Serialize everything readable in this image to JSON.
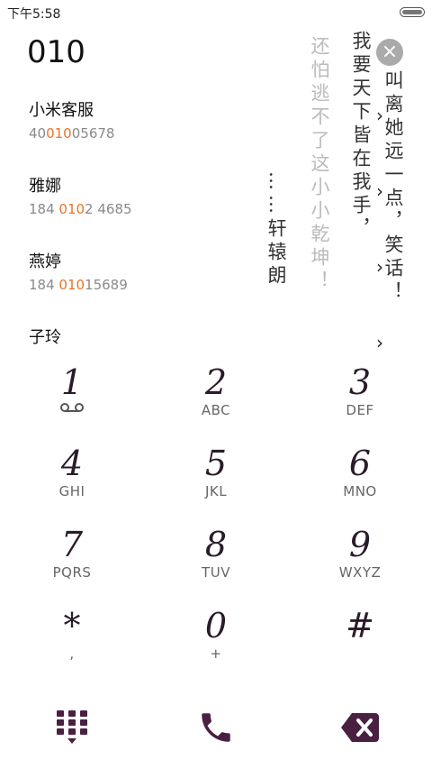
{
  "status_bar": {
    "time": "下午5:58"
  },
  "dialer": {
    "input_value": "010"
  },
  "results": [
    {
      "name": "小米客服",
      "num_pre": "40",
      "num_hl": "010",
      "num_post": "05678"
    },
    {
      "name": "雅娜",
      "num_pre": "184 ",
      "num_hl": "010",
      "num_post": "2 4685"
    },
    {
      "name": "燕婷",
      "num_pre": "184 ",
      "num_hl": "010",
      "num_post": "15689"
    },
    {
      "name": "子玲",
      "num_pre": "",
      "num_hl": "",
      "num_post": ""
    }
  ],
  "overlay_poem": {
    "col1": "叫离她远一点，笑话！",
    "col2": "我要天下皆在我手，",
    "col3": "还怕逃不了这小小乾坤！",
    "col4": "……轩辕朗"
  },
  "keypad": [
    {
      "digit": "1",
      "letters": ""
    },
    {
      "digit": "2",
      "letters": "ABC"
    },
    {
      "digit": "3",
      "letters": "DEF"
    },
    {
      "digit": "4",
      "letters": "GHI"
    },
    {
      "digit": "5",
      "letters": "JKL"
    },
    {
      "digit": "6",
      "letters": "MNO"
    },
    {
      "digit": "7",
      "letters": "PQRS"
    },
    {
      "digit": "8",
      "letters": "TUV"
    },
    {
      "digit": "9",
      "letters": "WXYZ"
    },
    {
      "digit": "*",
      "letters": ","
    },
    {
      "digit": "0",
      "letters": "+"
    },
    {
      "digit": "#",
      "letters": ""
    }
  ],
  "icons": {
    "close": "close-icon",
    "voicemail": "voicemail-icon",
    "dialpad_toggle": "dialpad-icon",
    "call": "phone-icon",
    "backspace": "backspace-icon"
  },
  "colors": {
    "accent": "#4a2040",
    "highlight": "#e8742a"
  }
}
